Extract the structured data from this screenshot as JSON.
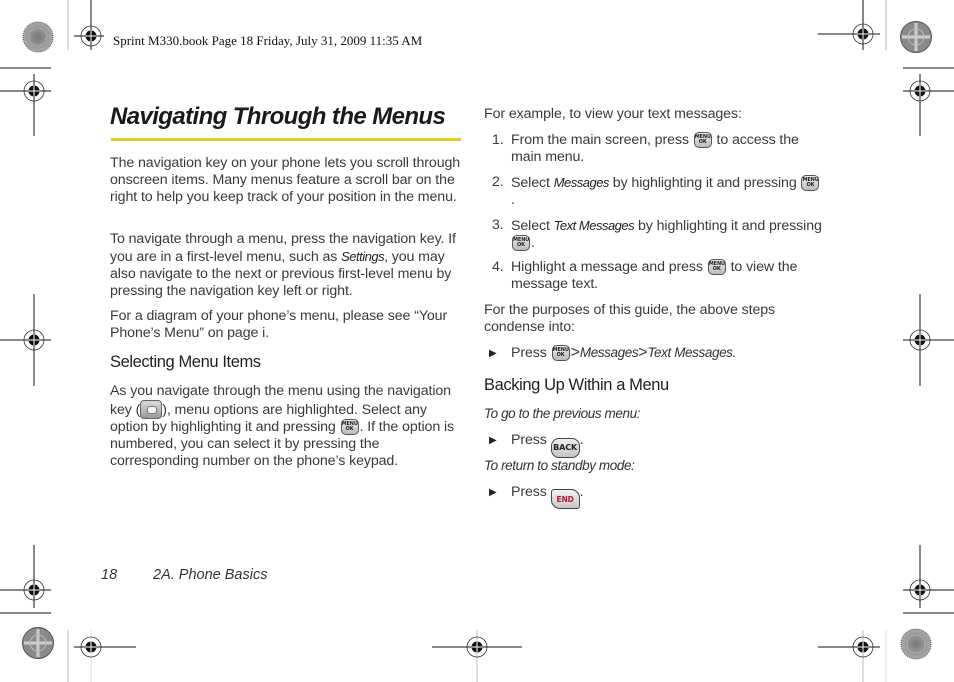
{
  "slug": "Sprint M330.book  Page 18  Friday, July 31, 2009  11:35 AM",
  "page_title": "Navigating Through the Menus",
  "accent_color": "#e8cc14",
  "left_column": {
    "para1": "The navigation key on your phone lets you scroll through onscreen items. Many menus feature a scroll bar on the right to help you keep track of your position in the menu.",
    "para2_before": "To navigate through a menu, press the navigation key. If you are in a first-level menu, such as ",
    "para2_italic": "Settings",
    "para2_after": ", you may also navigate to the next or previous first-level menu by pressing the navigation key left or right.",
    "para3": "For a diagram of your phone’s menu, please see “Your Phone’s Menu” on page i.",
    "heading": "Selecting Menu Items",
    "para4_a": "As you navigate through the menu using the navigation key (",
    "para4_b": "), menu options are highlighted. Select any option by highlighting it and pressing ",
    "para4_c": ". If the option is numbered, you can select it by pressing the corresponding number on the phone’s keypad."
  },
  "right_column": {
    "intro": "For example, to view your text messages:",
    "steps": [
      {
        "num": "1.",
        "a": "From the main screen, press ",
        "b": " to access the main menu."
      },
      {
        "num": "2.",
        "a": "Select ",
        "italic": "Messages",
        "b": " by highlighting it and pressing ",
        "c": "."
      },
      {
        "num": "3.",
        "a": "Select ",
        "italic": "Text Messages",
        "b": " by highlighting it and pressing ",
        "c": "."
      },
      {
        "num": "4.",
        "a": "Highlight a message and press ",
        "b": " to view the message text."
      }
    ],
    "condense": "For the purposes of this guide, the above steps condense into:",
    "press_label": "Press",
    "path_sep": ">",
    "path_1": "Messages",
    "path_2": "Text Messages.",
    "heading": "Backing Up Within a Menu",
    "prev_label": "To go to the previous menu:",
    "standby_label": "To return to standby mode:",
    "period": "."
  },
  "keys": {
    "menu_line1": "MENU",
    "menu_line2": "OK",
    "back": "BACK",
    "end": "END"
  },
  "icons": {
    "bullet": "▶"
  },
  "footer": {
    "page_number": "18",
    "section": "2A. Phone Basics"
  }
}
